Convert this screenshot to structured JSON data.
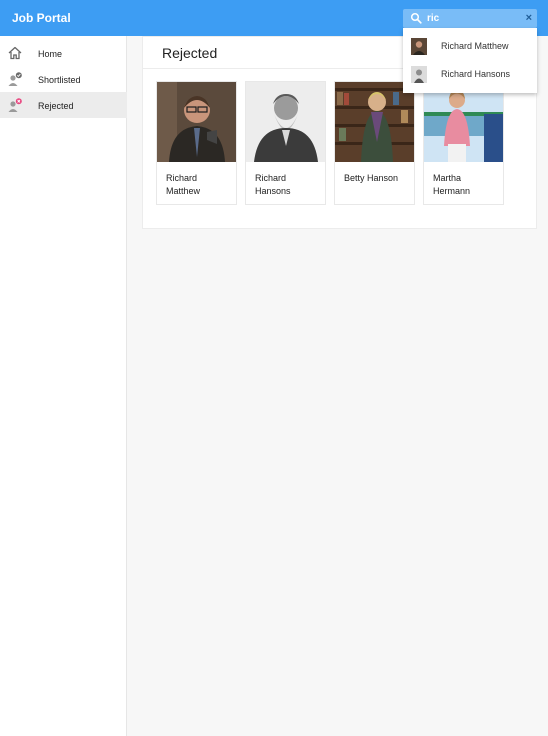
{
  "app": {
    "title": "Job Portal"
  },
  "search": {
    "value": "ric",
    "clear_glyph": "×"
  },
  "suggestions": [
    {
      "name": "Richard Matthew"
    },
    {
      "name": "Richard Hansons"
    }
  ],
  "sidebar": {
    "items": [
      {
        "label": "Home",
        "icon": "home-icon"
      },
      {
        "label": "Shortlisted",
        "icon": "person-check-icon"
      },
      {
        "label": "Rejected",
        "icon": "person-reject-icon",
        "active": true
      }
    ]
  },
  "main": {
    "title": "Rejected",
    "candidates": [
      {
        "name": "Richard Matthew"
      },
      {
        "name": "Richard Hansons"
      },
      {
        "name": "Betty Hanson"
      },
      {
        "name": "Martha Hermann"
      }
    ]
  },
  "colors": {
    "accent": "#3d9df3",
    "search_bg": "#79bcf7",
    "reject_badge": "#e8467f",
    "check_badge": "#6b6b6b"
  }
}
